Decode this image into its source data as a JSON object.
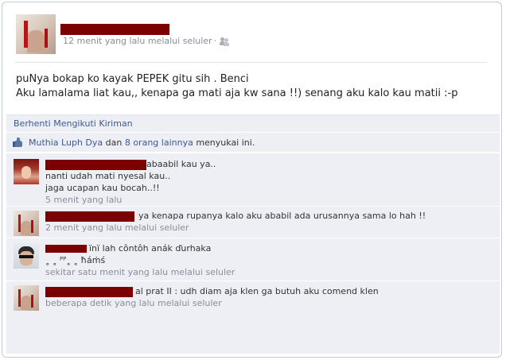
{
  "post": {
    "meta": "12 menit yang lalu melalui seluler",
    "separator": "·",
    "text_lines": [
      "puNya bokap ko kayak PEPEK gitu sih . Benci",
      "Aku lamalama liat kau,, kenapa ga mati aja kw sana !!) senang aku kalo kau matii :-p"
    ]
  },
  "actions": {
    "unfollow": "Berhenti Mengikuti Kiriman"
  },
  "likes": {
    "person": "Muthia Luph Dya",
    "and": " dan ",
    "others": "8 orang lainnya",
    "suffix": " menyukai ini."
  },
  "comments": [
    {
      "lines": [
        "abaabil kau ya..",
        "nanti udah mati nyesal kau..",
        "jaga ucapan kau bocah..!!"
      ],
      "time": "5 menit yang lalu"
    },
    {
      "lines": [
        "ya kenapa rupanya kalo aku ababil ada urusannya sama lo hah !!"
      ],
      "time": "2 menit yang lalu melalui seluler"
    },
    {
      "lines": [
        "ïnï lah côntôh anák ďurhaka",
        "˳ ˳ ᴾᴾ˳ ˳ ħáṁś"
      ],
      "time": "sekitar satu menit yang lalu melalui seluler"
    },
    {
      "lines": [
        "al prat II : udh diam aja klen ga butuh aku comend klen"
      ],
      "time": "beberapa detik yang lalu melalui seluler"
    }
  ]
}
